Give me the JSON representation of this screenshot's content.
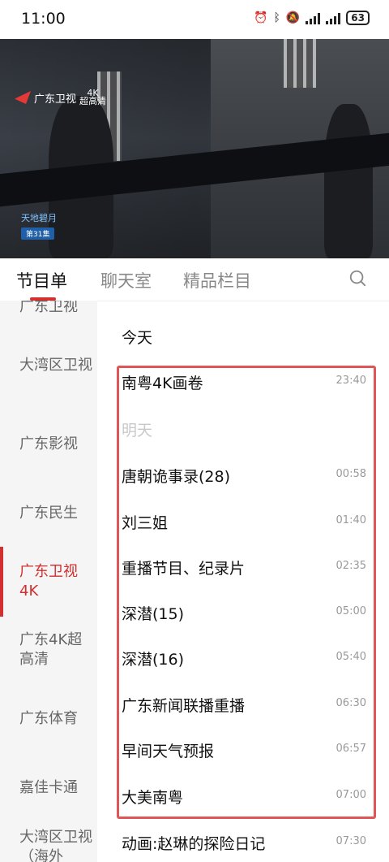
{
  "status_bar": {
    "time": "11:00",
    "battery": "63"
  },
  "video": {
    "channel_logo": "广东卫视",
    "quality_top": "4K",
    "quality_bottom": "超高清",
    "show_name": "天地碧月",
    "episode": "第31集"
  },
  "tabs": [
    {
      "label": "节目单"
    },
    {
      "label": "聊天室"
    },
    {
      "label": "精品栏目"
    }
  ],
  "sidebar": {
    "items": [
      {
        "label": "广东卫视"
      },
      {
        "label": "大湾区卫视"
      },
      {
        "label": "广东影视"
      },
      {
        "label": "广东民生"
      },
      {
        "label": "广东卫视4K"
      },
      {
        "label": "广东4K超高清"
      },
      {
        "label": "广东体育"
      },
      {
        "label": "嘉佳卡通"
      },
      {
        "label": "大湾区卫视（海外"
      }
    ]
  },
  "schedule": {
    "today_label": "今天",
    "tomorrow_label": "明天",
    "programs": [
      {
        "title": "南粤4K画卷",
        "time": "23:40"
      },
      {
        "title": "唐朝诡事录(28)",
        "time": "00:58"
      },
      {
        "title": "刘三姐",
        "time": "01:40"
      },
      {
        "title": "重播节目、纪录片",
        "time": "02:35"
      },
      {
        "title": "深潜(15)",
        "time": "05:00"
      },
      {
        "title": "深潜(16)",
        "time": "05:40"
      },
      {
        "title": "广东新闻联播重播",
        "time": "06:30"
      },
      {
        "title": "早间天气预报",
        "time": "06:57"
      },
      {
        "title": "大美南粤",
        "time": "07:00"
      },
      {
        "title": "动画:赵琳的探险日记",
        "time": "07:30"
      }
    ]
  }
}
